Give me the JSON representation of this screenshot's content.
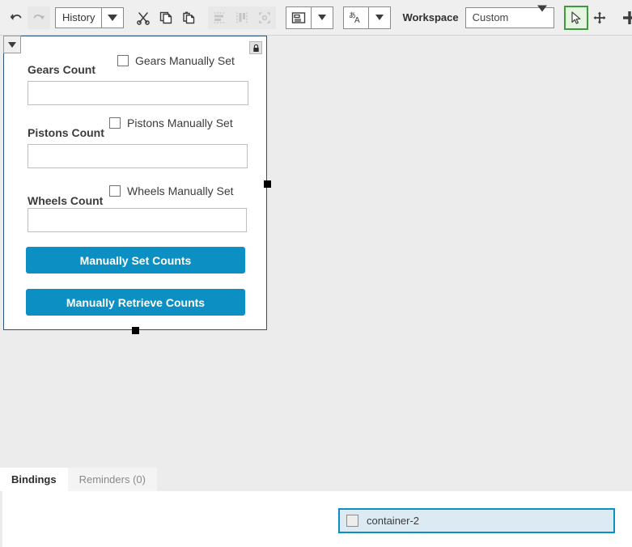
{
  "toolbar": {
    "undo_icon": "undo-arrow-icon",
    "redo_icon": "redo-arrow-icon",
    "history_label": "History",
    "cut_icon": "scissors-icon",
    "copy_icon": "copy-icon",
    "paste_icon": "paste-icon",
    "align_horizontal_icon": "align-horizontal-icon",
    "align_vertical_icon": "align-vertical-icon",
    "fit_icon": "fit-to-content-icon",
    "layout_icon": "layout-icon",
    "language_icon": "language-translate-icon",
    "workspace_label": "Workspace",
    "workspace_value": "Custom",
    "select_tool_icon": "cursor-select-icon",
    "pan_tool_icon": "move-pan-icon",
    "zoom_in_icon": "plus-icon",
    "zoom_out_icon": "minus-icon",
    "recenter_icon": "target-recenter-icon",
    "accent_active": "#3f9a3f"
  },
  "canvas": {
    "collapse_icon": "chevron-down-icon",
    "lock_icon": "lock-icon",
    "selection_border_color": "#2b5279",
    "form": {
      "fields": [
        {
          "label": "Gears Count",
          "checkbox_label": "Gears Manually Set",
          "checked": false,
          "value": ""
        },
        {
          "label": "Pistons Count",
          "checkbox_label": "Pistons Manually Set",
          "checked": false,
          "value": ""
        },
        {
          "label": "Wheels Count",
          "checkbox_label": "Wheels Manually Set",
          "checked": false,
          "value": ""
        }
      ],
      "buttons": [
        {
          "label": "Manually Set Counts",
          "color": "#0c90c4"
        },
        {
          "label": "Manually Retrieve Counts",
          "color": "#0c90c4"
        }
      ]
    }
  },
  "bottom": {
    "tabs": [
      {
        "label": "Bindings",
        "active": true
      },
      {
        "label": "Reminders (0)",
        "active": false
      }
    ],
    "binding": {
      "label": "container-2",
      "checked": false,
      "highlight_color": "#0c90c4"
    },
    "splitter_icon": "splitter-grip-icon"
  }
}
